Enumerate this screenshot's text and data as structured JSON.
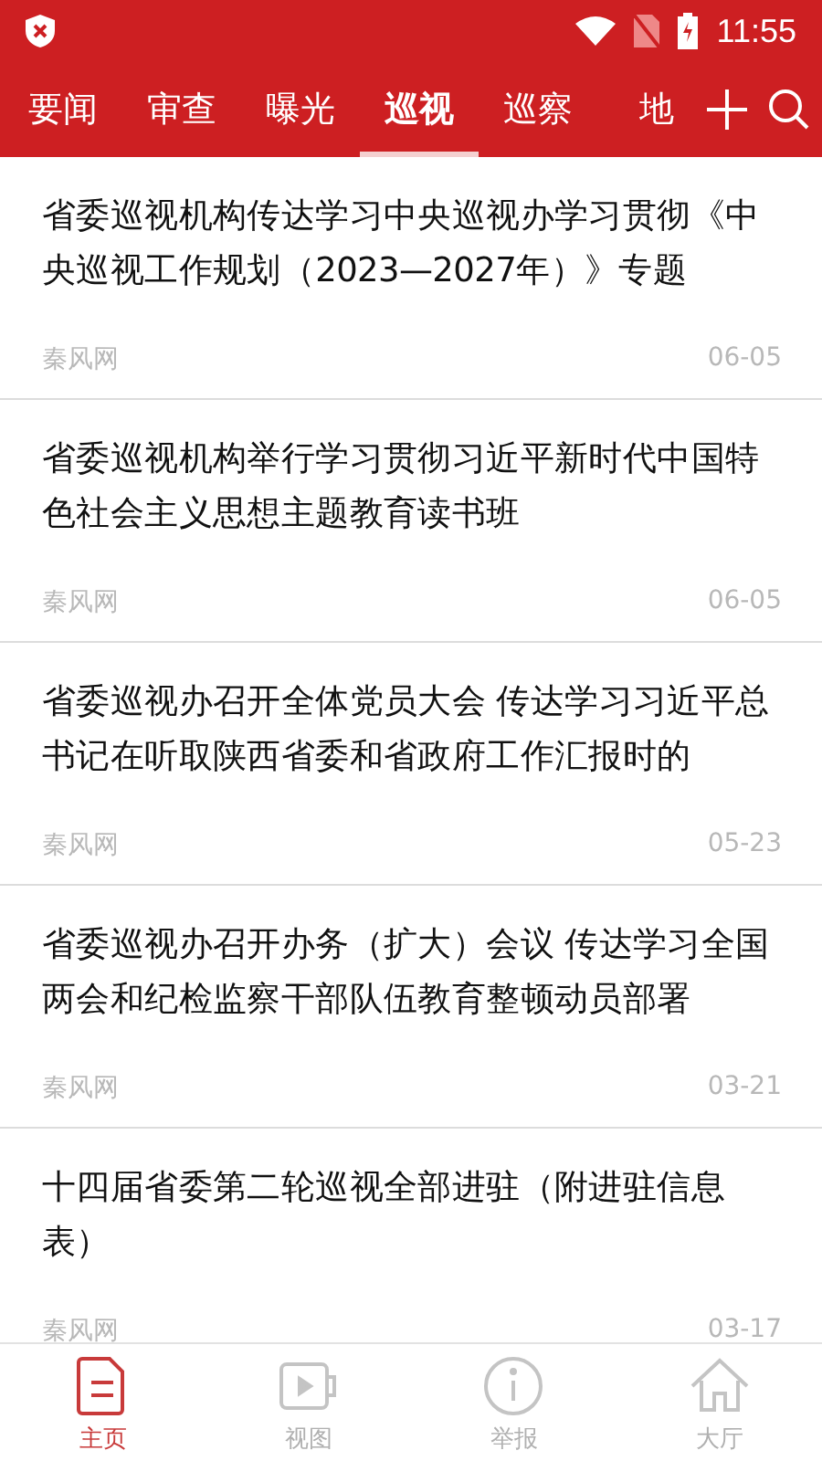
{
  "status_bar": {
    "time": "11:55"
  },
  "tabs": [
    {
      "label": "要闻",
      "selected": false
    },
    {
      "label": "审查",
      "selected": false
    },
    {
      "label": "曝光",
      "selected": false
    },
    {
      "label": "巡视",
      "selected": true
    },
    {
      "label": "巡察",
      "selected": false
    },
    {
      "label": "地",
      "selected": false
    }
  ],
  "articles": [
    {
      "title": "省委巡视机构传达学习中央巡视办学习贯彻《中央巡视工作规划（2023—2027年）》专题",
      "source": "秦风网",
      "date": "06-05"
    },
    {
      "title": "省委巡视机构举行学习贯彻习近平新时代中国特色社会主义思想主题教育读书班",
      "source": "秦风网",
      "date": "06-05"
    },
    {
      "title": "省委巡视办召开全体党员大会 传达学习习近平总书记在听取陕西省委和省政府工作汇报时的",
      "source": "秦风网",
      "date": "05-23"
    },
    {
      "title": "省委巡视办召开办务（扩大）会议 传达学习全国两会和纪检监察干部队伍教育整顿动员部署",
      "source": "秦风网",
      "date": "03-21"
    },
    {
      "title": "十四届省委第二轮巡视全部进驻（附进驻信息表）",
      "source": "秦风网",
      "date": "03-17"
    }
  ],
  "bottom_nav": [
    {
      "label": "主页",
      "kind": "document",
      "selected": true
    },
    {
      "label": "视图",
      "kind": "video",
      "selected": false
    },
    {
      "label": "举报",
      "kind": "info",
      "selected": false
    },
    {
      "label": "大厅",
      "kind": "home",
      "selected": false
    }
  ]
}
